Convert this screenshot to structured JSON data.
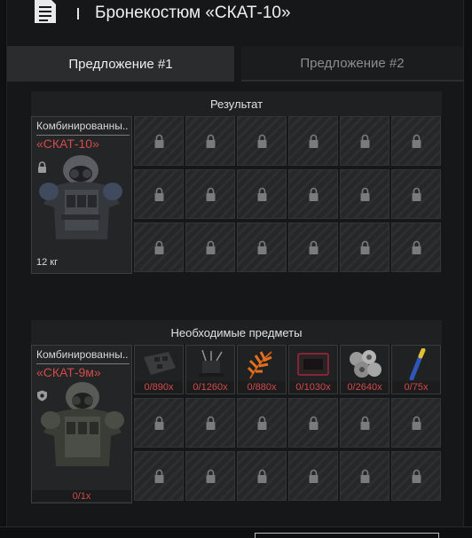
{
  "window": {
    "title": "Бронекостюм «СКАТ-10»"
  },
  "tabs": [
    {
      "label": "Предложение #1",
      "active": true
    },
    {
      "label": "Предложение #2",
      "active": false
    }
  ],
  "result": {
    "header": "Результат",
    "item": {
      "name": "Комбинированны..",
      "subtitle": "«СКАТ-10»",
      "weight": "12 кг",
      "icon": "lock-icon"
    }
  },
  "required": {
    "header": "Необходимые предметы",
    "item": {
      "name": "Комбинированны..",
      "subtitle": "«СКАТ-9м»",
      "count": "0/1x",
      "icon": "shield-icon"
    },
    "components": [
      {
        "icon": "electronic-block-icon",
        "count": "0/890x"
      },
      {
        "icon": "wires-component-icon",
        "count": "0/1260x"
      },
      {
        "icon": "orange-fern-icon",
        "count": "0/880x"
      },
      {
        "icon": "red-case-icon",
        "count": "0/1030x"
      },
      {
        "icon": "metal-scrap-icon",
        "count": "0/2640x"
      },
      {
        "icon": "blue-vial-icon",
        "count": "0/75x"
      }
    ]
  },
  "colors": {
    "accent_red": "#d44a4a",
    "panel": "#262728",
    "background": "#161718"
  }
}
